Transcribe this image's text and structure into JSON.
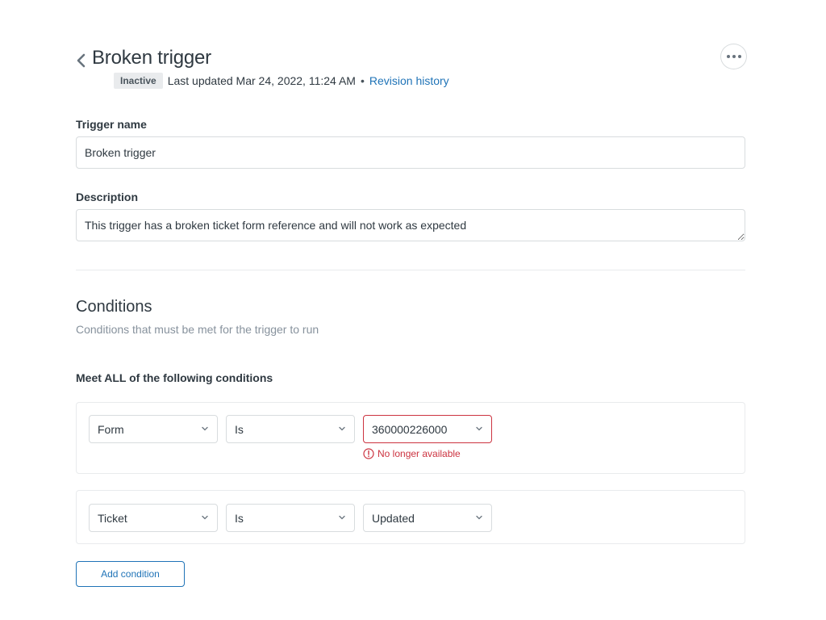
{
  "header": {
    "title": "Broken trigger",
    "status_badge": "Inactive",
    "last_updated": "Last updated Mar 24, 2022, 11:24 AM",
    "separator": "•",
    "revision_link": "Revision history",
    "back_icon": "chevron-left-icon",
    "more_icon": "ellipsis-icon"
  },
  "form": {
    "trigger_name_label": "Trigger name",
    "trigger_name_value": "Broken trigger",
    "description_label": "Description",
    "description_value": "This trigger has a broken ticket form reference and will not work as expected"
  },
  "conditions": {
    "title": "Conditions",
    "subtitle": "Conditions that must be met for the trigger to run",
    "all_label": "Meet ALL of the following conditions",
    "rows": [
      {
        "field": "Form",
        "operator": "Is",
        "value": "360000226000",
        "error": "No longer available"
      },
      {
        "field": "Ticket",
        "operator": "Is",
        "value": "Updated"
      }
    ],
    "add_button": "Add condition"
  },
  "colors": {
    "accent": "#1f73b7",
    "error": "#cc3340",
    "badge_bg": "#e9ebed",
    "text": "#2f3941",
    "muted": "#87929d"
  }
}
